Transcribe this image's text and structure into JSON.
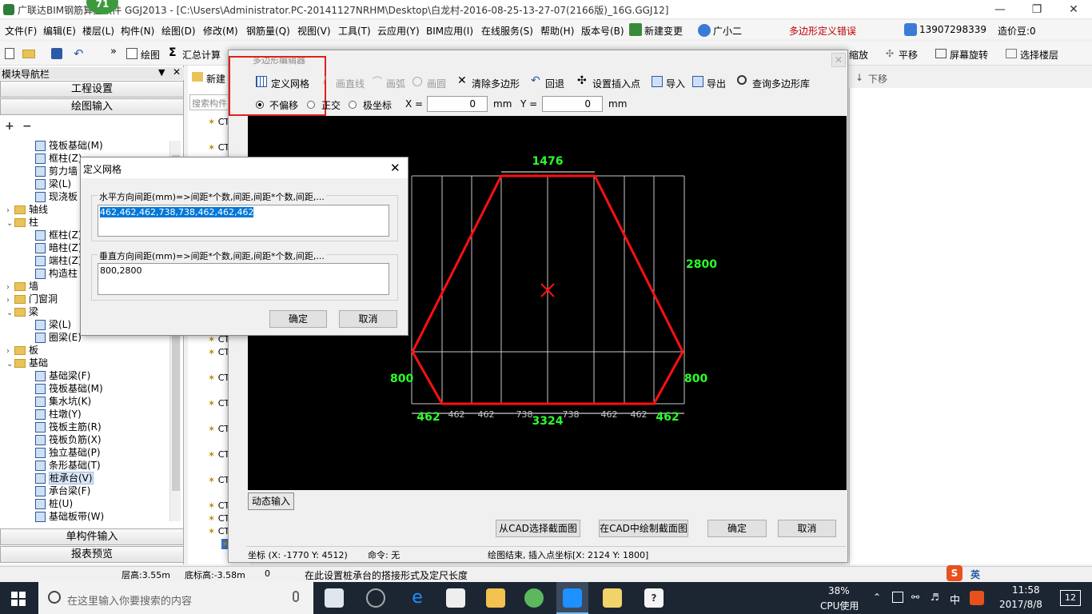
{
  "app": {
    "badge": "71",
    "title": "广联达BIM钢筋算量软件 GGJ2013 - [C:\\Users\\Administrator.PC-20141127NRHM\\Desktop\\白龙村-2016-08-25-13-27-07(2166版)_16G.GGJ12]"
  },
  "menu": {
    "items": [
      "文件(F)",
      "编辑(E)",
      "楼层(L)",
      "构件(N)",
      "绘图(D)",
      "修改(M)",
      "钢筋量(Q)",
      "视图(V)",
      "工具(T)",
      "云应用(Y)",
      "BIM应用(I)",
      "在线服务(S)",
      "帮助(H)",
      "版本号(B)"
    ],
    "change": "新建变更",
    "assistant": "广小二",
    "error": "多边形定义错误",
    "phone": "13907298339",
    "beans": "造价豆:0"
  },
  "toolbar": {
    "draw": "绘图",
    "sum": "汇总计算",
    "zoom": "缩放",
    "pan": "平移",
    "rotate": "屏幕旋转",
    "floor": "选择楼层",
    "down": "下移"
  },
  "nav": {
    "title": "模块导航栏",
    "project": "工程设置",
    "drawing": "绘图输入",
    "single": "单构件输入",
    "report": "报表预览",
    "items": [
      {
        "label": "筏板基础(M)",
        "level": 2
      },
      {
        "label": "框柱(Z)",
        "level": 2
      },
      {
        "label": "剪力墙",
        "level": 2
      },
      {
        "label": "梁(L)",
        "level": 2
      },
      {
        "label": "现浇板",
        "level": 2
      },
      {
        "label": "轴线",
        "level": 1,
        "folder": true,
        "exp": "+"
      },
      {
        "label": "柱",
        "level": 1,
        "folder": true,
        "exp": "-"
      },
      {
        "label": "框柱(Z)",
        "level": 2
      },
      {
        "label": "暗柱(Z)",
        "level": 2
      },
      {
        "label": "端柱(Z)",
        "level": 2
      },
      {
        "label": "构造柱",
        "level": 2
      },
      {
        "label": "墙",
        "level": 1,
        "folder": true,
        "exp": "+"
      },
      {
        "label": "门窗洞",
        "level": 1,
        "folder": true,
        "exp": "+"
      },
      {
        "label": "梁",
        "level": 1,
        "folder": true,
        "exp": "-"
      },
      {
        "label": "梁(L)",
        "level": 2
      },
      {
        "label": "圈梁(E)",
        "level": 2
      },
      {
        "label": "板",
        "level": 1,
        "folder": true,
        "exp": "+"
      },
      {
        "label": "基础",
        "level": 1,
        "folder": true,
        "exp": "-"
      },
      {
        "label": "基础梁(F)",
        "level": 2
      },
      {
        "label": "筏板基础(M)",
        "level": 2
      },
      {
        "label": "集水坑(K)",
        "level": 2
      },
      {
        "label": "柱墩(Y)",
        "level": 2
      },
      {
        "label": "筏板主筋(R)",
        "level": 2
      },
      {
        "label": "筏板负筋(X)",
        "level": 2
      },
      {
        "label": "独立基础(P)",
        "level": 2
      },
      {
        "label": "条形基础(T)",
        "level": 2
      },
      {
        "label": "桩承台(V)",
        "level": 2,
        "selected": true
      },
      {
        "label": "承台梁(F)",
        "level": 2
      },
      {
        "label": "桩(U)",
        "level": 2
      },
      {
        "label": "基础板带(W)",
        "level": 2
      }
    ]
  },
  "mid": {
    "new": "新建",
    "search_placeholder": "搜索构件...",
    "row_prefix": "CT"
  },
  "editor": {
    "title": "多边形编辑器",
    "tools": {
      "grid": "定义网格",
      "line": "画直线",
      "arc": "画弧",
      "circle": "画圆",
      "clear": "清除多边形",
      "undo": "回退",
      "insert": "设置插入点",
      "import": "导入",
      "export": "导出",
      "query": "查询多边形库"
    },
    "options": {
      "none": "不偏移",
      "ortho": "正交",
      "polar": "极坐标"
    },
    "x_label": "X =",
    "x_value": "0",
    "x_unit": "mm",
    "y_label": "Y =",
    "y_value": "0",
    "y_unit": "mm",
    "dynamic": "动态输入",
    "btn_cad_select": "从CAD选择截面图",
    "btn_cad_draw": "在CAD中绘制截面图",
    "ok": "确定",
    "cancel": "取消",
    "coord": "坐标 (X: -1770 Y: 4512)",
    "command": "命令: 无",
    "msg": "绘图结束, 插入点坐标[X: 2124 Y: 1800]",
    "dims": {
      "top": "1476",
      "right": "2800",
      "left_bottom": "800",
      "right_bottom": "800",
      "bottom_total": "3324",
      "bl": "462",
      "br": "462",
      "spacings": [
        "462",
        "462",
        "738",
        "738",
        "462",
        "462"
      ]
    }
  },
  "grid_dialog": {
    "title": "定义网格",
    "h_label": "水平方向间距(mm)=>间距*个数,间距,间距*个数,间距,...",
    "h_value": "462,462,462,738,738,462,462,462",
    "v_label": "垂直方向间距(mm)=>间距*个数,间距,间距*个数,间距,...",
    "v_value": "800,2800",
    "ok": "确定",
    "cancel": "取消"
  },
  "status": {
    "floor_height": "层高:3.55m",
    "base_height": "底标高:-3.58m",
    "zero": "0",
    "hint": "在此设置桩承台的搭接形式及定尺长度"
  },
  "taskbar": {
    "search": "在这里输入你要搜索的内容",
    "cpu_pct": "38%",
    "cpu_label": "CPU使用",
    "ime": "中",
    "time": "11:58",
    "date": "2017/8/8",
    "notif": "12",
    "ime_tray": "英"
  }
}
